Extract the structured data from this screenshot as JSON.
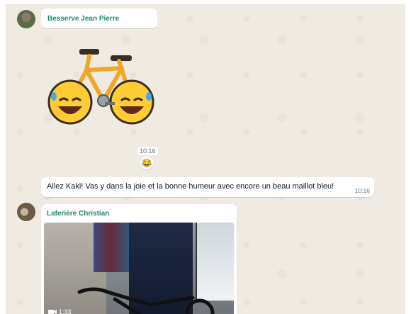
{
  "messages": [
    {
      "sender": "Besserve Jean Pierre",
      "type": "sticker",
      "sticker": "bicycle-laughing-wheels"
    },
    {
      "time": "10:16",
      "reaction": "😂"
    },
    {
      "text": "Allez Kaki! Vas y dans la joie et la bonne humeur avec encore un beau maillot bleu!",
      "time": "10:16"
    },
    {
      "sender": "Laferière Christian",
      "type": "video",
      "duration": "1:33"
    }
  ],
  "icons": {
    "video": "video-camera-icon"
  },
  "colors": {
    "sender_name": "#1f8a70",
    "chat_bg": "#efeae2",
    "bubble": "#ffffff"
  }
}
